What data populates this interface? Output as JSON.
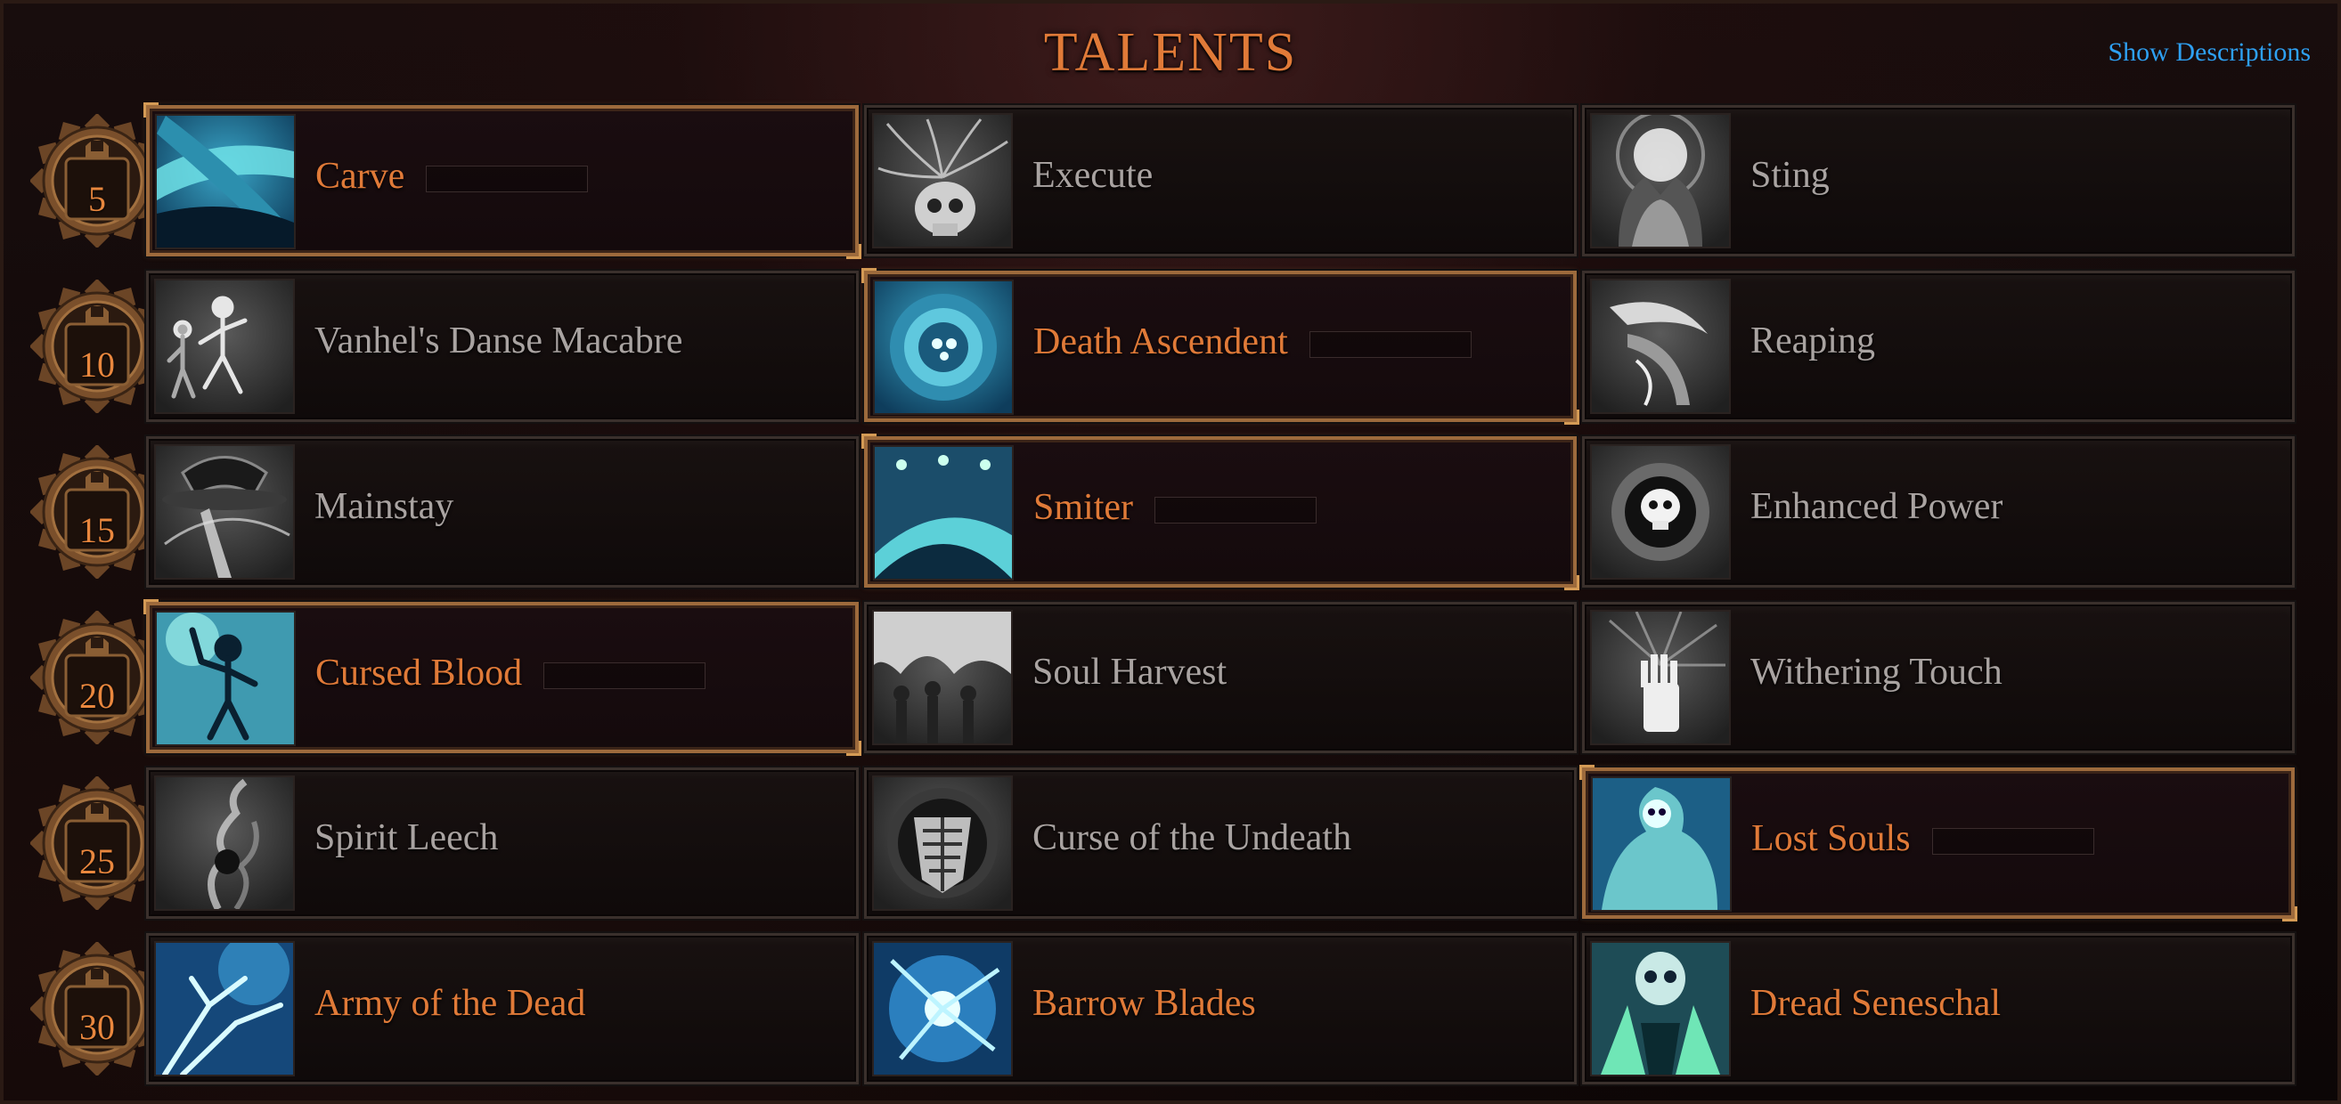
{
  "title": "TALENTS",
  "show_descriptions": "Show Descriptions",
  "colors": {
    "accent_orange": "#e07a38",
    "link_blue": "#2ea0f2",
    "locked_text": "#a9a3a1",
    "selected_border": "#9d6a3c"
  },
  "rows": [
    {
      "level": "5",
      "talents": [
        {
          "name": "Carve",
          "state": "selected",
          "icon": "carve-icon"
        },
        {
          "name": "Execute",
          "state": "locked",
          "icon": "skull-icon"
        },
        {
          "name": "Sting",
          "state": "locked",
          "icon": "sting-icon"
        }
      ]
    },
    {
      "level": "10",
      "talents": [
        {
          "name": "Vanhel's Danse Macabre",
          "state": "locked",
          "icon": "dancing-skeletons-icon"
        },
        {
          "name": "Death Ascendent",
          "state": "selected",
          "icon": "vortex-icon"
        },
        {
          "name": "Reaping",
          "state": "locked",
          "icon": "reaping-icon"
        }
      ]
    },
    {
      "level": "15",
      "talents": [
        {
          "name": "Mainstay",
          "state": "locked",
          "icon": "mainstay-icon"
        },
        {
          "name": "Smiter",
          "state": "selected",
          "icon": "smiter-icon"
        },
        {
          "name": "Enhanced Power",
          "state": "locked",
          "icon": "skull-emblem-icon"
        }
      ]
    },
    {
      "level": "20",
      "talents": [
        {
          "name": "Cursed Blood",
          "state": "selected",
          "icon": "cursed-blood-icon"
        },
        {
          "name": "Soul Harvest",
          "state": "locked",
          "icon": "soul-harvest-icon"
        },
        {
          "name": "Withering Touch",
          "state": "locked",
          "icon": "skeletal-hand-icon"
        }
      ]
    },
    {
      "level": "25",
      "talents": [
        {
          "name": "Spirit Leech",
          "state": "locked",
          "icon": "spirit-leech-icon"
        },
        {
          "name": "Curse of the Undeath",
          "state": "locked",
          "icon": "ribcage-shield-icon"
        },
        {
          "name": "Lost Souls",
          "state": "selected",
          "icon": "lost-souls-icon"
        }
      ]
    },
    {
      "level": "30",
      "talents": [
        {
          "name": "Army of the Dead",
          "state": "unlocked",
          "icon": "army-of-dead-icon"
        },
        {
          "name": "Barrow Blades",
          "state": "unlocked",
          "icon": "barrow-blades-icon"
        },
        {
          "name": "Dread Seneschal",
          "state": "unlocked",
          "icon": "dread-seneschal-icon"
        }
      ]
    }
  ]
}
